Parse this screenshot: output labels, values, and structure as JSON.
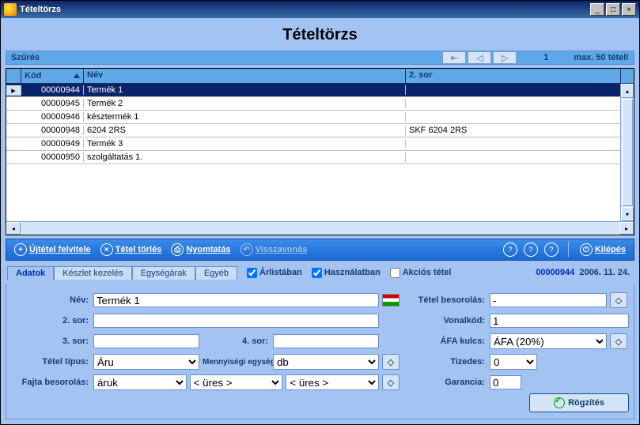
{
  "window_title": "Tételtörzs",
  "page_title": "Tételtörzs",
  "filter_label": "Szűrés",
  "nav": {
    "current": "1",
    "max_label": "max. 50 tétel!"
  },
  "grid": {
    "headers": {
      "kod": "Kód",
      "nev": "Név",
      "sor2": "2. sor"
    },
    "rows": [
      {
        "kod": "00000944",
        "nev": "Termék 1",
        "sor2": "",
        "selected": true
      },
      {
        "kod": "00000945",
        "nev": "Termék 2",
        "sor2": ""
      },
      {
        "kod": "00000946",
        "nev": "késztermék 1",
        "sor2": ""
      },
      {
        "kod": "00000948",
        "nev": "6204 2RS",
        "sor2": "SKF 6204 2RS"
      },
      {
        "kod": "00000949",
        "nev": "Termék 3",
        "sor2": ""
      },
      {
        "kod": "00000950",
        "nev": "szolgáltatás 1.",
        "sor2": ""
      }
    ]
  },
  "toolbar": {
    "new": "Újtétel felvitele",
    "delete": "Tétel törlés",
    "print": "Nyomtatás",
    "undo": "Visszavonás",
    "exit": "Kilépés"
  },
  "tabs": {
    "adatok": "Adatok",
    "keszlet": "Készlet kezelés",
    "egysegarak": "Egységárak",
    "egyeb": "Egyéb"
  },
  "checks": {
    "arlistaban": "Árlistában",
    "hasznalatban": "Használatban",
    "akcios": "Akciós tétel"
  },
  "datarow": {
    "code": "00000944",
    "date": "2006. 11. 24."
  },
  "form": {
    "nev_label": "Név:",
    "nev_value": "Termék 1",
    "sor2_label": "2. sor:",
    "sor2_value": "",
    "sor3_label": "3. sor:",
    "sor3_value": "",
    "sor4_label": "4. sor:",
    "sor4_value": "",
    "tipus_label": "Tétel típus:",
    "tipus_value": "Áru",
    "menny_label": "Mennyiségi egység:",
    "menny_value": "db",
    "fajta_label": "Fajta besorolás:",
    "fajta_v1": "áruk",
    "fajta_v2": "< üres >",
    "fajta_v3": "< üres >",
    "besor_label": "Tétel besorolás:",
    "besor_value": "-",
    "vonalkod_label": "Vonalkód:",
    "vonalkod_value": "1",
    "afa_label": "ÁFA kulcs:",
    "afa_value": "ÁFA (20%)",
    "tizedes_label": "Tizedes:",
    "tizedes_value": "0",
    "garancia_label": "Garancia:",
    "garancia_value": "0",
    "rogzites": "Rögzítés"
  }
}
